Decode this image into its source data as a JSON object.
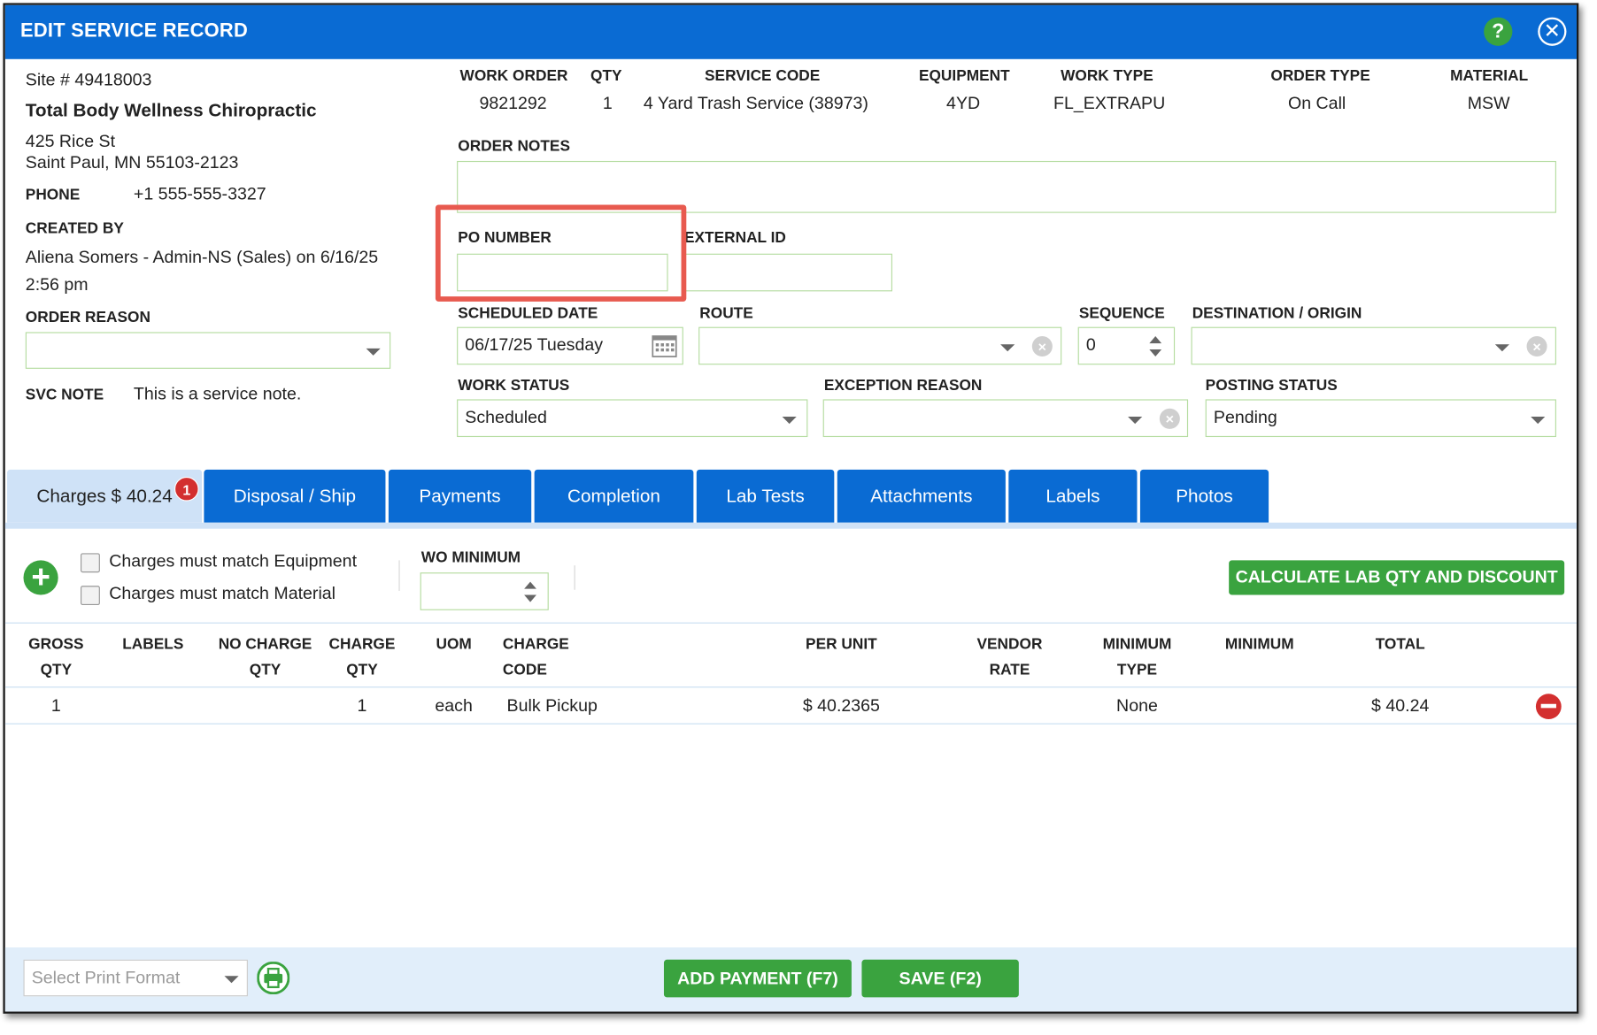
{
  "dialog": {
    "title": "EDIT SERVICE RECORD",
    "help_glyph": "?",
    "close_glyph": "✕"
  },
  "site": {
    "number": "Site # 49418003",
    "name": "Total Body Wellness Chiropractic",
    "address1": "425 Rice St",
    "address2": "Saint Paul, MN 55103-2123",
    "phone_label": "PHONE",
    "phone": "+1 555-555-3327",
    "created_by_label": "CREATED BY",
    "created_by_line1": "Aliena Somers - Admin-NS (Sales) on 6/16/25",
    "created_by_line2": "2:56 pm",
    "order_reason_label": "ORDER REASON",
    "order_reason_value": "",
    "svc_note_label": "SVC NOTE",
    "svc_note": "This is a service note."
  },
  "order": {
    "headers": [
      "WORK ORDER",
      "QTY",
      "SERVICE CODE",
      "EQUIPMENT",
      "WORK TYPE",
      "ORDER TYPE",
      "MATERIAL"
    ],
    "values": [
      "9821292",
      "1",
      "4 Yard Trash Service (38973)",
      "4YD",
      "FL_EXTRAPU",
      "On Call",
      "MSW"
    ],
    "notes_label": "ORDER NOTES",
    "notes_value": ""
  },
  "fields": {
    "po_number_label": "PO NUMBER",
    "po_number_value": "",
    "external_id_label": "EXTERNAL ID",
    "external_id_value": "",
    "scheduled_date_label": "SCHEDULED DATE",
    "scheduled_date_value": "06/17/25 Tuesday",
    "route_label": "ROUTE",
    "route_value": "",
    "sequence_label": "SEQUENCE",
    "sequence_value": "0",
    "destination_label": "DESTINATION / ORIGIN",
    "destination_value": "",
    "work_status_label": "WORK STATUS",
    "work_status_value": "Scheduled",
    "exception_reason_label": "EXCEPTION REASON",
    "exception_reason_value": "",
    "posting_status_label": "POSTING STATUS",
    "posting_status_value": "Pending"
  },
  "tabs": [
    {
      "label": "Charges $ 40.24",
      "active": true,
      "badge": "1"
    },
    {
      "label": "Disposal / Ship"
    },
    {
      "label": "Payments"
    },
    {
      "label": "Completion"
    },
    {
      "label": "Lab Tests"
    },
    {
      "label": "Attachments"
    },
    {
      "label": "Labels"
    },
    {
      "label": "Photos"
    }
  ],
  "charges": {
    "match_equipment_label": "Charges must match Equipment",
    "match_material_label": "Charges must match Material",
    "wo_minimum_label": "WO MINIMUM",
    "wo_minimum_value": "",
    "calc_button": "CALCULATE LAB QTY AND DISCOUNT",
    "columns": [
      {
        "line1": "GROSS",
        "line2": "QTY"
      },
      {
        "line1": "LABELS",
        "line2": ""
      },
      {
        "line1": "NO CHARGE",
        "line2": "QTY"
      },
      {
        "line1": "CHARGE",
        "line2": "QTY"
      },
      {
        "line1": "UOM",
        "line2": ""
      },
      {
        "line1": "CHARGE CODE",
        "line2": ""
      },
      {
        "line1": "PER UNIT",
        "line2": ""
      },
      {
        "line1": "VENDOR",
        "line2": "RATE"
      },
      {
        "line1": "MINIMUM",
        "line2": "TYPE"
      },
      {
        "line1": "MINIMUM",
        "line2": ""
      },
      {
        "line1": "TOTAL",
        "line2": ""
      }
    ],
    "rows": [
      {
        "gross_qty": "1",
        "labels": "",
        "no_charge_qty": "",
        "charge_qty": "1",
        "uom": "each",
        "charge_code": "Bulk Pickup",
        "per_unit": "$ 40.2365",
        "vendor_rate": "",
        "minimum_type": "None",
        "minimum": "",
        "total": "$ 40.24"
      }
    ]
  },
  "footer": {
    "print_format_placeholder": "Select Print Format",
    "add_payment": "ADD PAYMENT (F7)",
    "save": "SAVE (F2)"
  },
  "colors": {
    "header_blue": "#0a6bd3",
    "green": "#3aa33f",
    "highlight": "#e85a4f",
    "field_border": "#b5dca0"
  }
}
